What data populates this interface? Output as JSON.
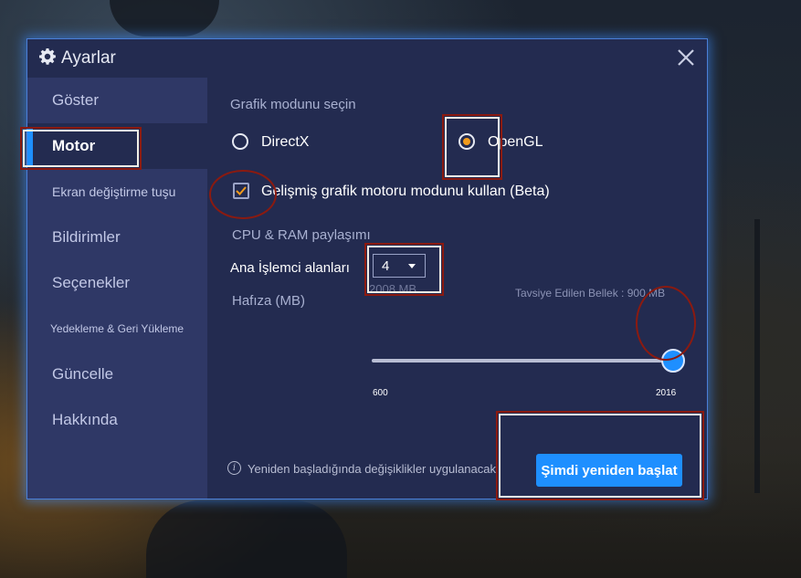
{
  "dialog": {
    "title": "Ayarlar",
    "title_icon": "gear-icon",
    "close_icon": "close-icon"
  },
  "sidebar": {
    "items": [
      {
        "label": "Göster"
      },
      {
        "label": "Motor"
      },
      {
        "label": "Ekran değiştirme tuşu"
      },
      {
        "label": "Bildirimler"
      },
      {
        "label": "Seçenekler"
      },
      {
        "label": "Yedekleme & Geri Yükleme"
      },
      {
        "label": "Güncelle"
      },
      {
        "label": "Hakkında"
      }
    ],
    "active_index": 1
  },
  "engine": {
    "graphics_mode_label": "Grafik modunu seçin",
    "option_directx": "DirectX",
    "option_opengl": "OpenGL",
    "selected_mode": "OpenGL",
    "advanced_checkbox_label": "Gelişmiş grafik motoru modunu kullan (Beta)",
    "advanced_checked": true,
    "cpu_ram_label": "CPU & RAM paylaşımı",
    "cpu_cores_label": "Ana İşlemci alanları",
    "cpu_cores_value": "4",
    "memory_label": "Hafıza (MB)",
    "memory_current": "2008 MB",
    "recommended_memory": "Tavsiye Edilen Bellek : 900 MB",
    "memory_min": "600",
    "memory_max": "2016",
    "memory_fraction": 1.0
  },
  "footer": {
    "info_icon": "info-icon",
    "info_text": "Yeniden başladığında değişiklikler uygulanacak",
    "restart_button": "Şimdi yeniden başlat"
  },
  "colors": {
    "accent": "#1e8fff",
    "selected_radio": "#f29b1c",
    "highlight_box": "#8b1a10"
  }
}
